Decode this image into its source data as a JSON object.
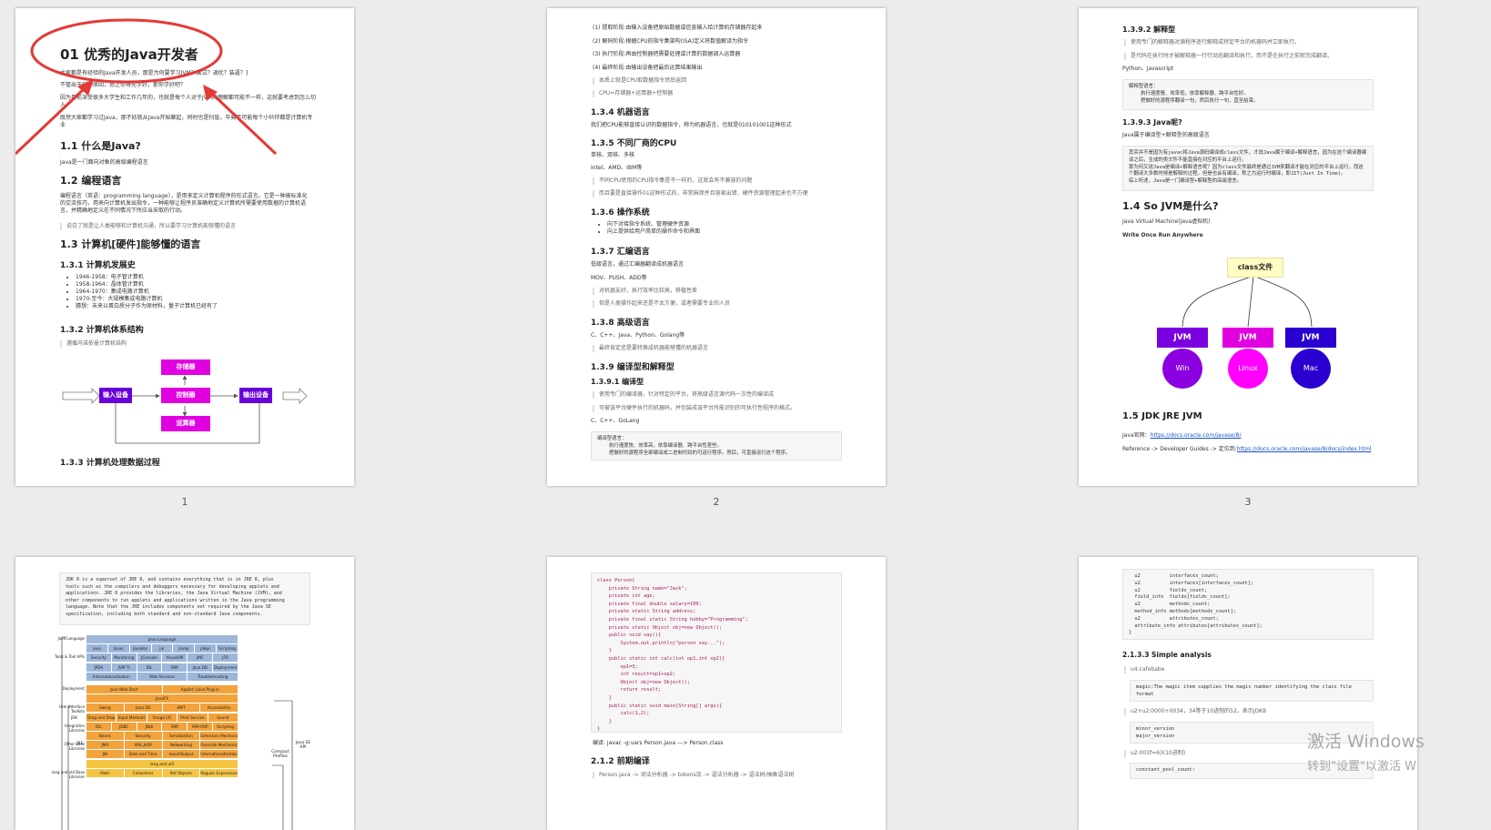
{
  "pages": [
    "1",
    "2",
    "3"
  ],
  "page1": {
    "title": "01 优秀的Java开发者",
    "intro1": "大家都是有经验的Java开发人员，那是为何要学习JVM？面试？调优？装逼？]",
    "intro2": "不管出于何种原因，总之你得先学好，那你学好吧？",
    "intro3": "因为目前深受很多大学生和工作几年的，也就是每个人对于JVM的理解都可能不一样，这就要考虑到怎么切入",
    "intro4": "既然大家都学习过Java，那不妨就从Java开始聊起，同时也是扫盲，毕竟不可能每个小伙伴都是计算机专业",
    "h_what": "1.1 什么是Java?",
    "what_text": "Java是一门面向对象的高级编程语言",
    "h_lang": "1.2 编程语言",
    "lang_text": "编程语言（英语：programming language），是用来定义计算机程序的形式语言。它是一种被标准化的交流技巧，用来向计算机发出指令，一种能够让程序员准确地定义计算机所需要使用数据的计算机语言，并精确地定义在不同情况下所应当采取的行动。",
    "lang_quote": "说白了就是让人类能够和计算机沟通，所以要学习计算机能够懂的语言",
    "h_hw": "1.3 计算机[硬件]能够懂的语言",
    "h_hist": "1.3.1 计算机发展史",
    "hist": [
      "1946-1958：电子管计算机",
      "1958-1964：晶体管计算机",
      "1964-1970：集成电路计算机",
      "1970-至今：大规模集成电路计算机",
      "猜想：未来以蛋白质分子作为原材料，量子计算机已经有了"
    ],
    "h_arch": "1.3.2 计算机体系结构",
    "arch_quote": "遵循冯诺依曼计算机结构",
    "diagram": {
      "storage": "存储器",
      "input": "输入设备",
      "control": "控制器",
      "output": "输出设备",
      "alu": "运算器"
    },
    "h_proc": "1.3.3 计算机处理数据过程"
  },
  "page2": {
    "steps": [
      "(1) 提取阶段:由输入设备把原始数据或信息输入给计算机存储器存起来",
      "(2) 解码阶段:根据CPU的指令集架构(ISA)定义将数值解译为指令",
      "(3) 执行阶段:再由控制器把需要处理或计算的数据调入运算器",
      "(4) 最终阶段:由输出设备把最后运算结果输出"
    ],
    "q1": "本质上就是CPU取数据指令然后返回",
    "q2": "CPU=存储器+运算器+控制器",
    "h_ml": "1.3.4 机器语言",
    "ml_text": "我们把CPU能够直接认识的数据指令，称为机器语言，也就是010101001这种形式",
    "h_cpu": "1.3.5 不同厂商的CPU",
    "cpu1": "单核、双核、多核",
    "cpu2": "Intel、AMD、IBM等",
    "cpu_q1": "不同CPU使用的CPU指令集是不一样的，这就会有不兼容的问题",
    "cpu_q2": "而且要是直接操作01这种形式的，非常麻烦并且容易出错，硬件资源管理起来也不方便",
    "h_os": "1.3.6 操作系统",
    "os": [
      "向下对接指令系统、管理硬件资源",
      "向上提供给用户简单的操作命令和界面"
    ],
    "h_asm": "1.3.7 汇编语言",
    "asm_text": "低级语言，通过汇编器翻译成机器语言",
    "asm2": "MOV、PUSH、ADD等",
    "asm_q1": "对机器友好，执行效率比较高，移植性差",
    "asm_q2": "但是人类操作起来还是不太方便，或者需要专业的人员",
    "h_high": "1.3.8 高级语言",
    "high_text": "C、C++、Java、Python、Golang等",
    "high_q": "最终肯定还是要转换成机器能够懂的机器语言",
    "h_ci": "1.3.9 编译型和解释型",
    "h_c": "1.3.9.1 编译型",
    "c_q1": "使用专门的编译器，针对特定的平台，将高级语言源代码一次性的编译成",
    "c_q2": "可被该平台硬件执行的机器码，并包装成该平台所能识别的可执行性程序的格式。",
    "c_lang": "C、C++、GoLang",
    "c_code": "编译型语言：\n    执行速度快、效率高，依靠编译器、跨平台性差些。\n    把做好的源程序全部编译成二进制代码的可运行程序。然后，可直接运行这个程序。"
  },
  "page3": {
    "h_interp": "1.3.9.2 解释型",
    "i_q1": "使用专门的解释器对源程序逐行解释成特定平台的机器码并立即执行。",
    "i_q2": "是代码在执行时才被解释器一行行动态翻译和执行，而不是在执行之前就完成翻译。",
    "i_lang": "Python、Javascript",
    "i_code": "解释型语言：\n    执行速度慢、效率低，依靠解释器、跨平台性好。\n    把做好的源程序翻译一句，然后执行一句，直至结束。",
    "h_java": "1.3.9.3 Java呢?",
    "java_text": "Java属于编译型+解释型的高级语言",
    "java_code": "其实并不是因为有javac将Java源码编译成class文件，才说Java属于编译+解释语言，因为在这个编译器编\n译之后，生成的类文件不能直接在对应的平台上运行。\n那为何又说Java是编译+解释语言呢？因为class文件最终是通过JVM来翻译才能在对应的平台上运行，而这\n个翻译大多数时候是解释的过程，但是也会有编译，称之为运行时编译，即JIT(Just In Time)。\n综上所述，Java是一门编译型+解释型的高级语言。",
    "h_jvm": "1.4 So JVM是什么?",
    "jvm1": "Java Virtual Machine(Java虚拟机)",
    "jvm2": "Write Once Run Anywhere",
    "classfile": "class文件",
    "jvm_label": "JVM",
    "os": [
      "Win",
      "Linux",
      "Mac"
    ],
    "h_jdk": "1.5 JDK JRE JVM",
    "jdk1_label": "Java官网：",
    "jdk1_link": "https://docs.oracle.com/javase/8/",
    "jdk2_label": "Reference -> Developer Guides -> 定位到:",
    "jdk2_link": "https://docs.oracle.com/javase/8/docs/index.html"
  },
  "page4": {
    "code": "JDK 8 is a superset of JRE 8, and contains everything that is in JRE 8, plus\ntools such as the compilers and debuggers necessary for developing applets and\napplications. JRE 8 provides the libraries, the Java Virtual Machine (JVM), and\nother components to run applets and applications written in the Java programming\nlanguage. Note that the JRE includes components not required by the Java SE\nspecification, including both standard and non-standard Java components.",
    "rows": [
      {
        "label": "Java Language",
        "cls": "blue",
        "cells": [
          "Java Language"
        ]
      },
      {
        "label": "",
        "cls": "blue",
        "cells": [
          "java",
          "javac",
          "javadoc",
          "jar",
          "javap",
          "jdeps",
          "Scripting"
        ]
      },
      {
        "label": "Tools & Tool APIs",
        "cls": "blue",
        "cells": [
          "Security",
          "Monitoring",
          "JConsole",
          "VisualVM",
          "JMC",
          "JFR"
        ]
      },
      {
        "label": "",
        "cls": "blue",
        "cells": [
          "JPDA",
          "JVM TI",
          "IDL",
          "RMI",
          "Java DB",
          "Deployment"
        ]
      },
      {
        "label": "",
        "cls": "blue",
        "cells": [
          "Internationalization",
          "Web Services",
          "Troubleshooting"
        ]
      },
      {
        "label": "Deployment",
        "cls": "orange",
        "cells": [
          "Java Web Start",
          "Applet / Java Plug-in"
        ]
      },
      {
        "label": "",
        "cls": "orange",
        "cells": [
          "JavaFX"
        ]
      },
      {
        "label": "User Interface Toolkits",
        "cls": "orange",
        "cells": [
          "Swing",
          "Java 2D",
          "AWT",
          "Accessibility"
        ]
      },
      {
        "label": "",
        "cls": "orange",
        "cells": [
          "Drag and Drop",
          "Input Methods",
          "Image I/O",
          "Print Service",
          "Sound"
        ]
      },
      {
        "label": "Integration Libraries",
        "cls": "orange",
        "cells": [
          "IDL",
          "JDBC",
          "JNDI",
          "RMI",
          "RMI-IIOP",
          "Scripting"
        ]
      },
      {
        "label": "",
        "cls": "orange",
        "cells": [
          "Beans",
          "Security",
          "Serialization",
          "Extension Mechanism"
        ]
      },
      {
        "label": "Other Base Libraries",
        "cls": "orange",
        "cells": [
          "JMX",
          "XML JAXP",
          "Networking",
          "Override Mechanism"
        ]
      },
      {
        "label": "",
        "cls": "orange",
        "cells": [
          "JNI",
          "Date and Time",
          "Input/Output",
          "Internationalization"
        ]
      },
      {
        "label": "",
        "cls": "yellow",
        "cells": [
          "lang and util"
        ]
      },
      {
        "label": "lang and util Base Libraries",
        "cls": "yellow",
        "cells": [
          "Math",
          "Collections",
          "Ref Objects",
          "Regular Expressions"
        ]
      }
    ],
    "side_jdk": "JDK",
    "side_jre": "JRE",
    "side_api": "Java SE API",
    "side_profiles": "Compact Profiles"
  },
  "page5": {
    "code": "class Person{\n    private String name=\"Jack\";\n    private int age;\n    private final double salary=100;\n    private static String address;\n    private final static String hobby=\"Programming\";\n    private static Object obj=new Object();\n    public void say(){\n        System.out.println(\"person say...\");\n    }\n    public static int calc(int op1,int op2){\n        op1=3;\n        int result=op1+op2;\n        Object obj=new Object();\n        return result;\n    }\n    public static void main(String[] args){\n        calc(1,2);\n    }\n}",
    "cmd": "编译: javac -g:vars Person.java ---> Person.class",
    "h_pre": "2.1.2 前期编译",
    "pre_text": "Person.java -> 词法分析器 -> tokens流 -> 语法分析器 -> 语法树/抽象语法树"
  },
  "page6": {
    "code": "  u2          interfaces_count;\n  u2          interfaces[interfaces_count];\n  u2          fields_count;\n  field_info  fields[fields_count];\n  u2          methods_count;\n  method_info methods[methods_count];\n  u2          attributes_count;\n  attribute_info attributes[attributes_count];\n}",
    "h_simple": "2.1.3.3 Simple analysis",
    "u4": "u4:cafebabe",
    "magic": "magic:The magic item supplies the magic number identifying the class file\nformat",
    "u2": "u2+u2:0000+0034，34等于10进制的52，表示JDK8",
    "ver": "minor_version\nmajor_version",
    "u2b": "u2:003f=63(10进制)",
    "pool": "constant_pool_count:"
  },
  "watermark": {
    "line1": "激活 Windows",
    "line2": "转到\"设置\"以激活 W"
  },
  "colors": {
    "annotation": "#e53935",
    "purple": "#6a00d8",
    "magenta": "#e000e0",
    "blue_jvm": "#2a00d0",
    "note": "#fffcc4"
  }
}
